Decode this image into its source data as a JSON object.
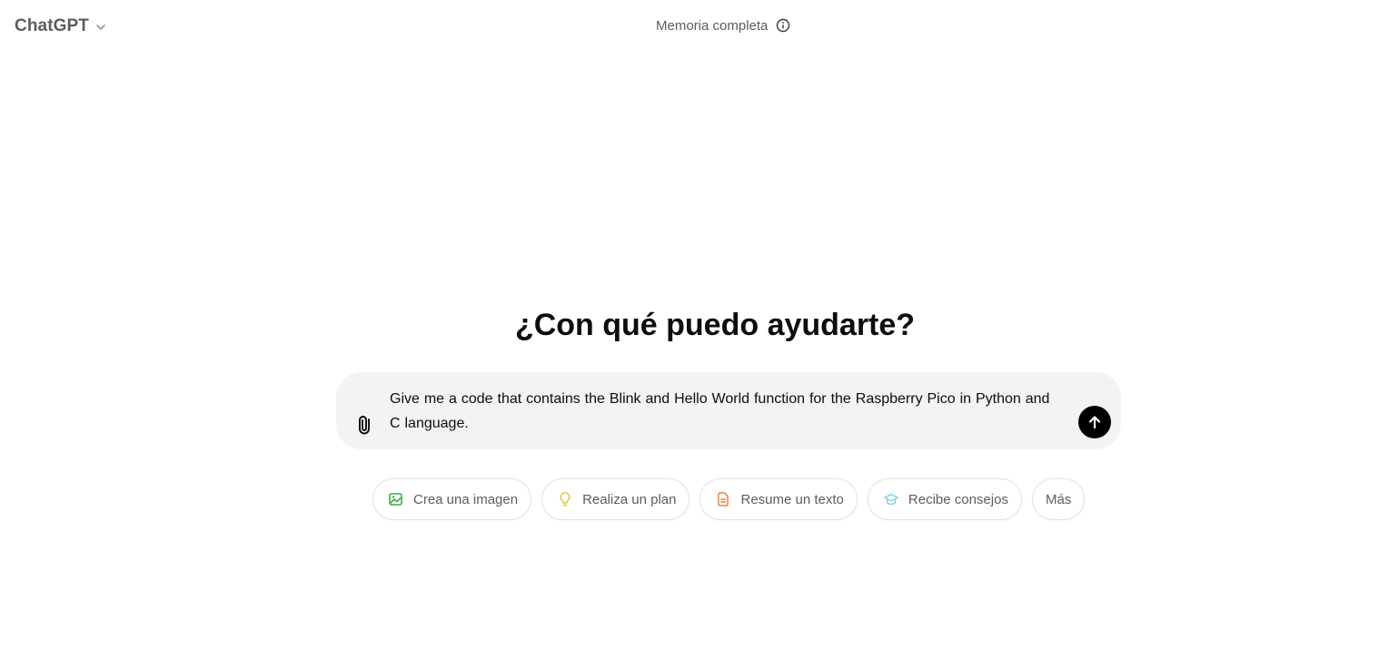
{
  "header": {
    "model_name": "ChatGPT",
    "memory_label": "Memoria completa"
  },
  "main": {
    "heading": "¿Con qué puedo ayudarte?"
  },
  "composer": {
    "prompt_text": "Give me a code that contains the Blink and Hello World function for the Raspberry Pico in Python and C language."
  },
  "suggestions": [
    {
      "label": "Crea una imagen",
      "icon": "image-icon",
      "color": "#35ae47"
    },
    {
      "label": "Realiza un plan",
      "icon": "lightbulb-icon",
      "color": "#e2c541"
    },
    {
      "label": "Resume un texto",
      "icon": "document-icon",
      "color": "#ea8444"
    },
    {
      "label": "Recibe consejos",
      "icon": "graduation-cap-icon",
      "color": "#76d0eb"
    },
    {
      "label": "Más"
    }
  ],
  "colors": {
    "composer_background": "#f3f3f3",
    "send_button": "#000000",
    "muted_text": "#5d5d5d"
  }
}
